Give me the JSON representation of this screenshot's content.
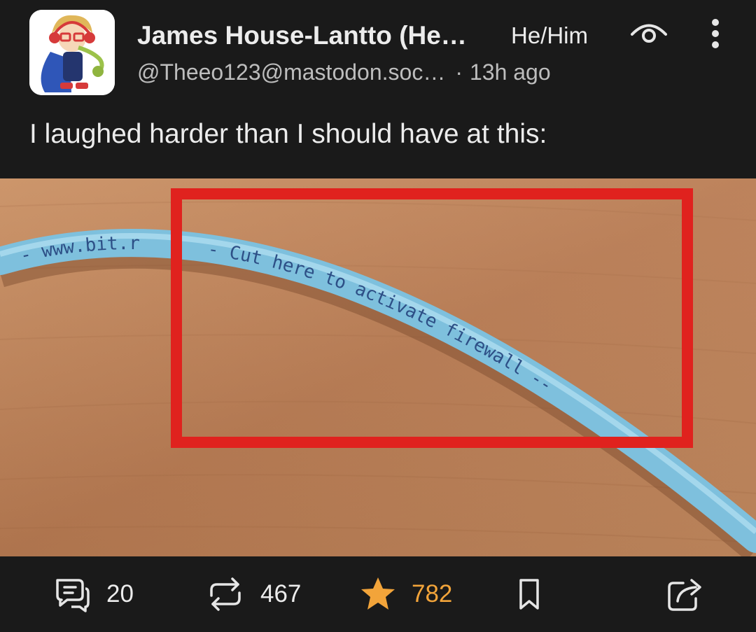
{
  "post": {
    "author": {
      "display_name": "James House-Lantto (He…",
      "pronouns": "He/Him",
      "handle": "@Theeo123@mastodon.soc…",
      "time_ago": "13h ago",
      "separator": "·"
    },
    "text": "I laughed harder than I should have at this:",
    "media": {
      "cable_text_left": "- www.bit.r",
      "cable_text_main": "- Cut here to activate firewall --",
      "highlight_color": "#e0221e"
    }
  },
  "actions": {
    "replies": "20",
    "boosts": "467",
    "favourites": "782"
  },
  "colors": {
    "background": "#1a1a1a",
    "text": "#ececec",
    "muted": "#bdbdbd",
    "favourite": "#f2a43a"
  },
  "icons": [
    "reply-icon",
    "boost-icon",
    "star-icon",
    "bookmark-icon",
    "share-icon",
    "eye-icon",
    "more-vertical-icon"
  ]
}
